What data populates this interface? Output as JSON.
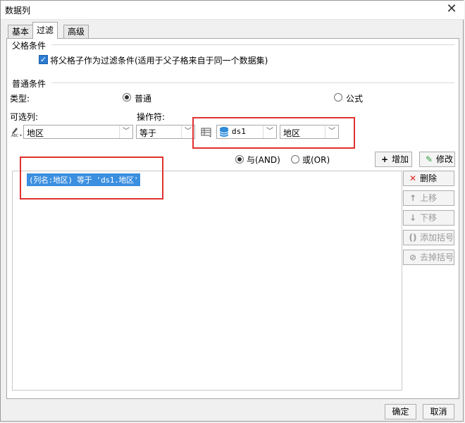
{
  "window": {
    "title": "数据列"
  },
  "tabs": [
    {
      "label": "基本"
    },
    {
      "label": "过滤"
    },
    {
      "label": "高级"
    }
  ],
  "parent_section": {
    "title": "父格条件",
    "checkbox_label": "将父格子作为过滤条件(适用于父子格来自于同一个数据集)"
  },
  "common_section": {
    "title": "普通条件",
    "type_label": "类型:",
    "type_normal": "普通",
    "type_formula": "公式",
    "column_label": "可选列:",
    "column_value": "地区",
    "operator_label": "操作符:",
    "operator_value": "等于",
    "dataset_value": "ds1",
    "field_value": "地区",
    "and_label": "与(AND)",
    "or_label": "或(OR)",
    "add_button": "增加",
    "modify_button": "修改"
  },
  "conditions": [
    {
      "text": "(列名:地区) 等于 'ds1.地区'"
    }
  ],
  "side_buttons": {
    "delete": "删除",
    "move_up": "上移",
    "move_down": "下移",
    "add_bracket": "添加括号",
    "remove_bracket": "去掉括号"
  },
  "footer": {
    "ok": "确定",
    "cancel": "取消"
  },
  "colors": {
    "highlight_border": "#e0322f",
    "selection": "#3b8fe0",
    "checkbox": "#2b7cd3"
  }
}
